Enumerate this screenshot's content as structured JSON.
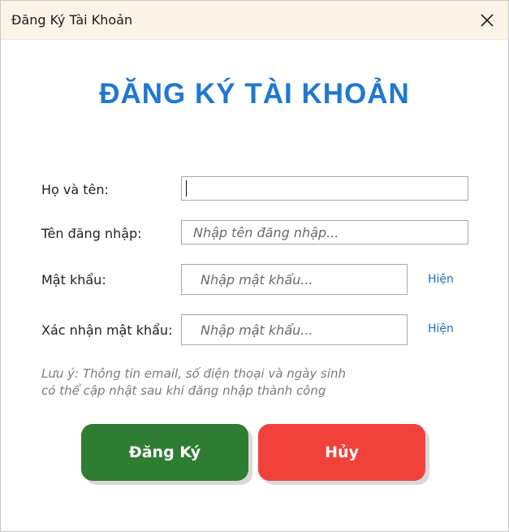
{
  "window": {
    "title": "Đăng Ký Tài Khoản"
  },
  "form": {
    "heading": "ĐĂNG KÝ TÀI KHOẢN",
    "fields": [
      {
        "label": "Họ và tên:",
        "value": "",
        "placeholder": ""
      },
      {
        "label": "Tên đăng nhập:",
        "value": "",
        "placeholder": "Nhập tên đăng nhập..."
      },
      {
        "label": "Mật khẩu:",
        "value": "",
        "placeholder": "Nhập mật khẩu..."
      },
      {
        "label": "Xác nhận mật khẩu:",
        "value": "",
        "placeholder": "Nhập mật khẩu..."
      }
    ],
    "show_password_label": "Hiện",
    "show_confirm_label": "Hiện",
    "note_line1": "Lưu ý: Thông tin email, số điện thoại và ngày sinh",
    "note_line2": "có thể cập nhật sau khi đăng nhập thành công"
  },
  "buttons": {
    "register_label": "Đăng Ký",
    "cancel_label": "Hủy"
  },
  "colors": {
    "heading": "#1f78d1",
    "register": "#2e7d32",
    "cancel": "#f0423b",
    "link": "#1f6fbf",
    "titlebar": "#faf3e6"
  }
}
